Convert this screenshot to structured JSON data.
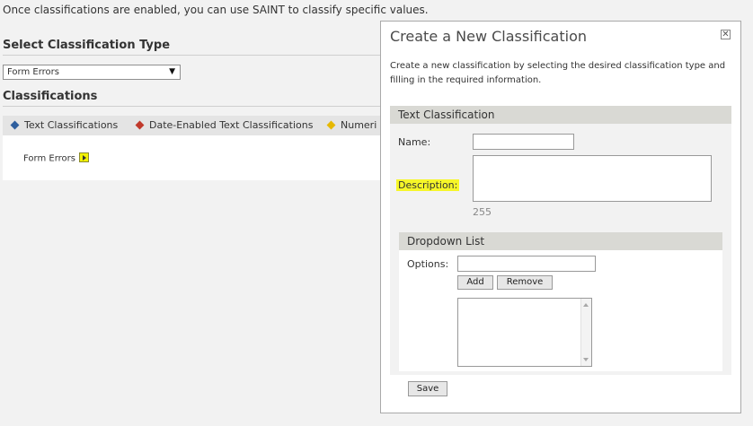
{
  "intro_text": "Once classifications are enabled, you can use SAINT to classify specific values.",
  "select_section": {
    "title": "Select Classification Type",
    "selected_value": "Form Errors"
  },
  "classifications_section": {
    "title": "Classifications",
    "legend": [
      {
        "label": "Text Classifications",
        "color": "#2e5f9e"
      },
      {
        "label": "Date-Enabled Text Classifications",
        "color": "#c0392b"
      },
      {
        "label": "Numeri",
        "color": "#e6b800"
      }
    ],
    "item_label": "Form Errors"
  },
  "modal": {
    "title": "Create a New Classification",
    "description": "Create a new classification by selecting the desired classification type and filling in the required information.",
    "text_classification": {
      "header": "Text Classification",
      "name_label": "Name:",
      "name_value": "",
      "description_label": "Description:",
      "description_value": "",
      "char_count": "255"
    },
    "dropdown_list": {
      "header": "Dropdown List",
      "options_label": "Options:",
      "options_value": "",
      "add_label": "Add",
      "remove_label": "Remove"
    },
    "save_label": "Save"
  }
}
